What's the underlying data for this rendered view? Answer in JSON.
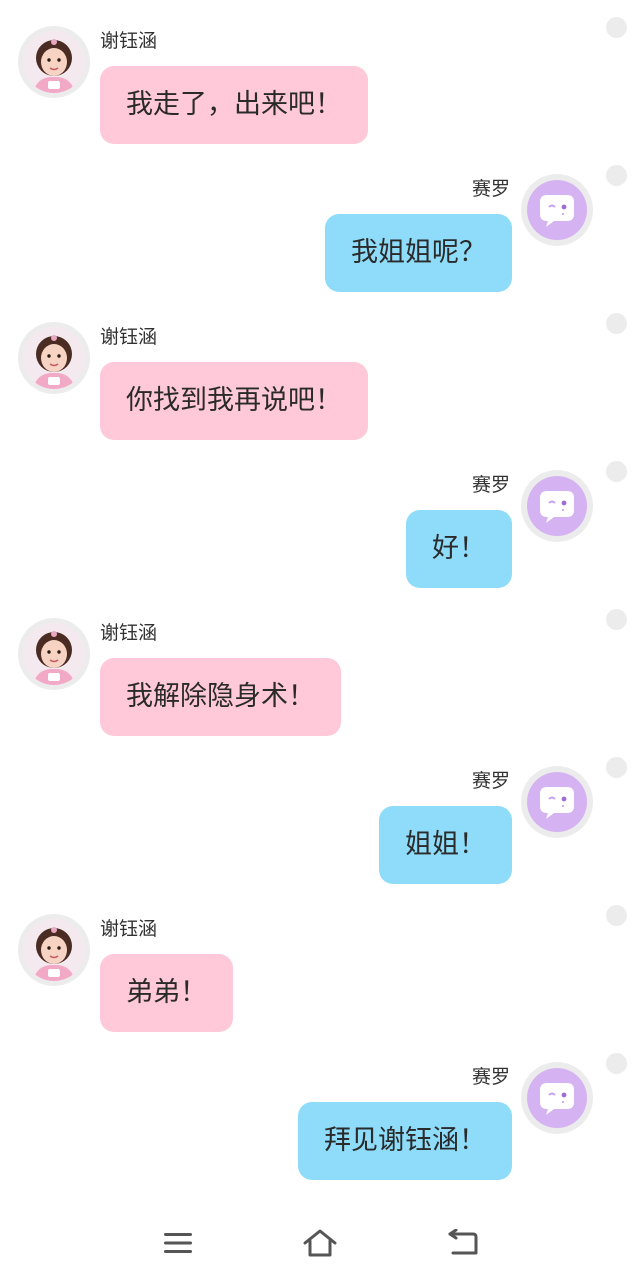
{
  "chat": {
    "messages": [
      {
        "side": "left",
        "sender": "谢钰涵",
        "text": "我走了，出来吧！"
      },
      {
        "side": "right",
        "sender": "赛罗",
        "text": "我姐姐呢？"
      },
      {
        "side": "left",
        "sender": "谢钰涵",
        "text": "你找到我再说吧！"
      },
      {
        "side": "right",
        "sender": "赛罗",
        "text": "好！"
      },
      {
        "side": "left",
        "sender": "谢钰涵",
        "text": "我解除隐身术！"
      },
      {
        "side": "right",
        "sender": "赛罗",
        "text": "姐姐！"
      },
      {
        "side": "left",
        "sender": "谢钰涵",
        "text": "弟弟！"
      },
      {
        "side": "right",
        "sender": "赛罗",
        "text": "拜见谢钰涵！"
      }
    ]
  },
  "colors": {
    "left_bubble": "#ffc9d9",
    "right_bubble": "#8edcfa",
    "bot_avatar": "#d5b3f2"
  },
  "navbar": {
    "icons": [
      "menu-icon",
      "home-icon",
      "back-icon"
    ]
  }
}
